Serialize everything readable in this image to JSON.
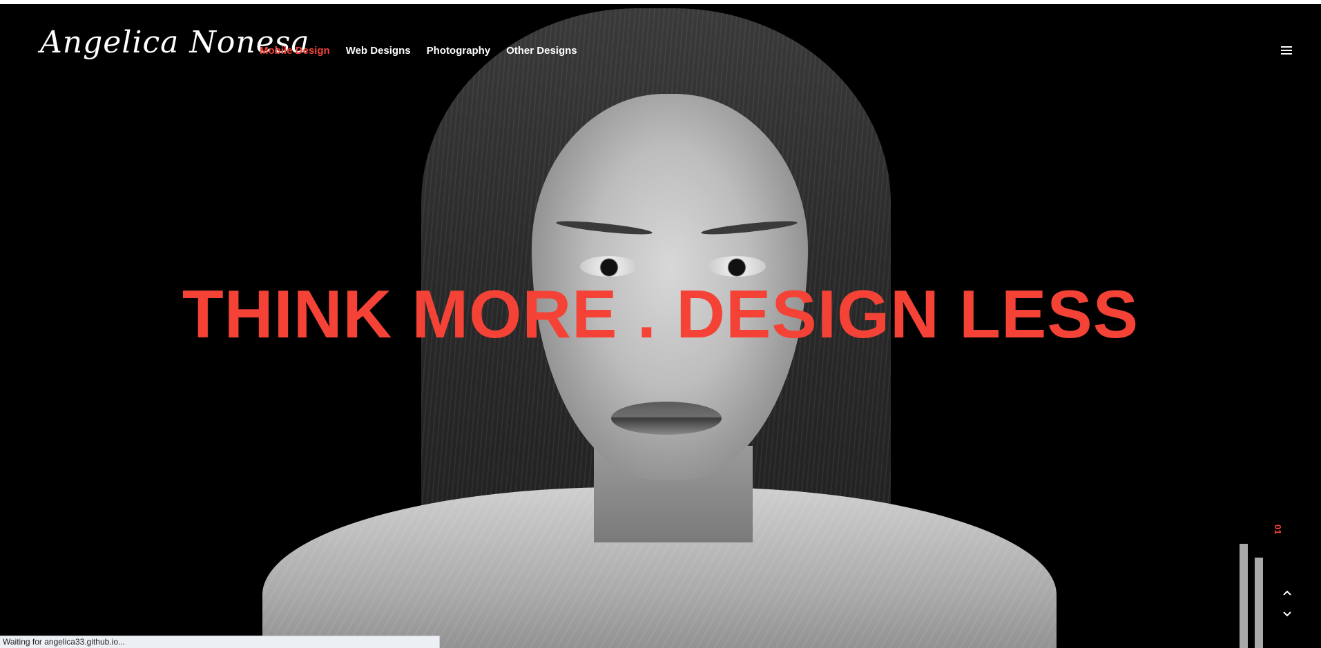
{
  "header": {
    "logo_text": "Angelica Nonesa",
    "nav": [
      {
        "label": "Mobile Design",
        "active": true
      },
      {
        "label": "Web Designs",
        "active": false
      },
      {
        "label": "Photography",
        "active": false
      },
      {
        "label": "Other Designs",
        "active": false
      }
    ],
    "menu_icon": "hamburger-menu-icon"
  },
  "hero": {
    "headline": "THINK MORE . DESIGN LESS",
    "image": "black-and-white portrait"
  },
  "slider": {
    "current_slide": "01",
    "prev_icon": "chevron-up-icon",
    "next_icon": "chevron-down-icon"
  },
  "status_bar": {
    "text": "Waiting for angelica33.github.io..."
  },
  "colors": {
    "accent": "#f44336",
    "background": "#000000",
    "text": "#ffffff",
    "indicator_bar": "#a9a9a9"
  }
}
